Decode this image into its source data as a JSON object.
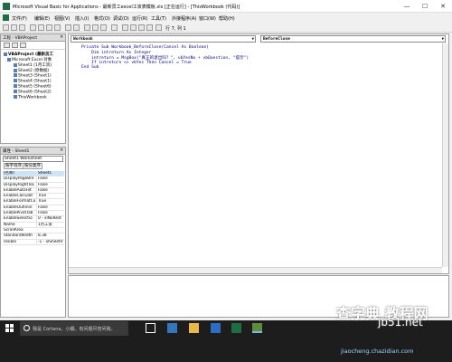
{
  "window": {
    "title": "Microsoft Visual Basic for Applications - 最新员工excel工资表模板.xls [正在运行] - [ThisWorkbook (代码)]",
    "minimize": "—",
    "maximize": "☐",
    "close": "✕"
  },
  "menu": {
    "items": [
      "文件(F)",
      "编辑(E)",
      "视图(V)",
      "插入(I)",
      "格式(O)",
      "调试(D)",
      "运行(R)",
      "工具(T)",
      "外接程序(A)",
      "窗口(W)",
      "帮助(H)"
    ]
  },
  "toolbar": {
    "status": "行 7, 列 1"
  },
  "project_panel": {
    "title": "工程 - VBAProject",
    "close": "✕",
    "tree": [
      "VBAProject (最新员工",
      "Microsoft Excel 对象",
      "Sheet1 (1月工资)",
      "Sheet2 (原数据)",
      "Sheet3 (Sheet1)",
      "Sheet4 (Sheet1)",
      "Sheet5 (Sheet6)",
      "Sheet6 (Sheet2)",
      "ThisWorkbook"
    ]
  },
  "properties_panel": {
    "title": "属性 - Sheet1",
    "close": "✕",
    "object_select": "Sheet1 Worksheet",
    "tabs": [
      "按字母序",
      "按分类序"
    ],
    "rows": [
      {
        "name": "(名称)",
        "value": "Sheet1"
      },
      {
        "name": "DisplayPageBre",
        "value": "False"
      },
      {
        "name": "DisplayRightToL",
        "value": "False"
      },
      {
        "name": "EnableAutoFilt",
        "value": "False"
      },
      {
        "name": "EnableCalculat",
        "value": "True"
      },
      {
        "name": "EnableFormatCo",
        "value": "True"
      },
      {
        "name": "EnableOutlinin",
        "value": "False"
      },
      {
        "name": "EnablePivotTab",
        "value": "False"
      },
      {
        "name": "EnableSelectio",
        "value": "0 - xlNoRest"
      },
      {
        "name": "Name",
        "value": "1月工资"
      },
      {
        "name": "ScrollArea",
        "value": ""
      },
      {
        "name": "StandardWidth",
        "value": "8.38"
      },
      {
        "name": "Visible",
        "value": "-1 - xlSheetV"
      }
    ]
  },
  "code_window": {
    "object_combo": "Workbook",
    "procedure_combo": "BeforeClose",
    "lines": [
      "Private Sub Workbook_BeforeClose(Cancel As Boolean)",
      "    Dim intreturn As Integer",
      "    intreturn = MsgBox(\"真正的退出吗？\", vbYesNo + vbQuestion, \"提示\")",
      "    If intreturn <> vbYes Then Cancel = True",
      "End Sub"
    ]
  },
  "taskbar": {
    "search_placeholder": "我是 Cortana，小娜。有问题尽管问我。"
  },
  "watermark": {
    "logo": "查字典 教程网",
    "site": "jb51.net",
    "url": "jiaocheng.chazidian.com"
  }
}
